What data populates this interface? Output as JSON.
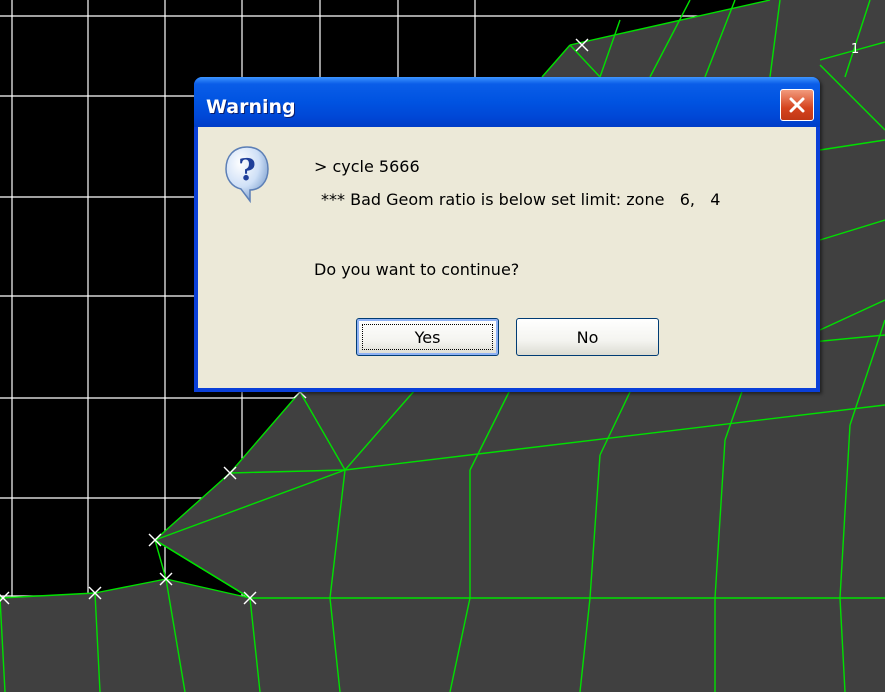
{
  "dialog": {
    "title": "Warning",
    "message_line1": "> cycle 5666",
    "message_line2": "*** Bad Geom ratio is below set limit: zone   6,   4",
    "question": "Do you want to continue?",
    "yes_label": "Yes",
    "no_label": "No",
    "icon": "question-icon",
    "close_icon": "close-icon"
  },
  "viewport": {
    "corner_label": "1",
    "colors": {
      "background": "#000000",
      "grid": "#ffffff",
      "mesh_fill": "#404040",
      "mesh_lines": "#00ff00"
    }
  }
}
